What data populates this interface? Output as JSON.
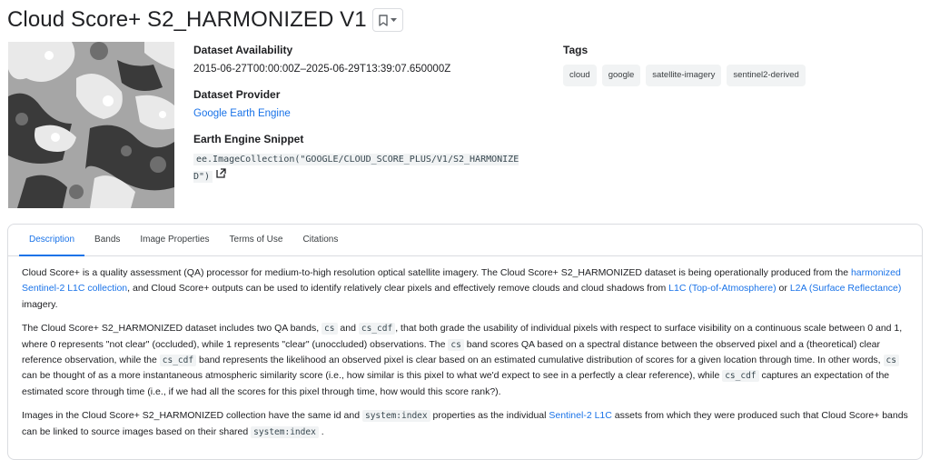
{
  "header": {
    "title": "Cloud Score+ S2_HARMONIZED V1"
  },
  "availability": {
    "label": "Dataset Availability",
    "value": "2015-06-27T00:00:00Z–2025-06-29T13:39:07.650000Z"
  },
  "provider": {
    "label": "Dataset Provider",
    "value": "Google Earth Engine"
  },
  "snippet": {
    "label": "Earth Engine Snippet",
    "value": "ee.ImageCollection(\"GOOGLE/CLOUD_SCORE_PLUS/V1/S2_HARMONIZED\")"
  },
  "tags": {
    "label": "Tags",
    "items": [
      "cloud",
      "google",
      "satellite-imagery",
      "sentinel2-derived"
    ]
  },
  "tabs": [
    "Description",
    "Bands",
    "Image Properties",
    "Terms of Use",
    "Citations"
  ],
  "description": {
    "p1": {
      "t1": "Cloud Score+ is a quality assessment (QA) processor for medium-to-high resolution optical satellite imagery. The Cloud Score+ S2_HARMONIZED dataset is being operationally produced from the ",
      "link1": "harmonized Sentinel-2 L1C collection",
      "t2": ", and Cloud Score+ outputs can be used to identify relatively clear pixels and effectively remove clouds and cloud shadows from ",
      "link2": "L1C (Top-of-Atmosphere)",
      "t3": " or ",
      "link3": "L2A (Surface Reflectance)",
      "t4": " imagery."
    },
    "p2": {
      "t1": "The Cloud Score+ S2_HARMONIZED dataset includes two QA bands, ",
      "c1": "cs",
      "t2": " and ",
      "c2": "cs_cdf",
      "t3": ", that both grade the usability of individual pixels with respect to surface visibility on a continuous scale between 0 and 1, where 0 represents \"not clear\" (occluded), while 1 represents \"clear\" (unoccluded) observations. The ",
      "c3": "cs",
      "t4": " band scores QA based on a spectral distance between the observed pixel and a (theoretical) clear reference observation, while the ",
      "c4": "cs_cdf",
      "t5": " band represents the likelihood an observed pixel is clear based on an estimated cumulative distribution of scores for a given location through time. In other words, ",
      "c5": "cs",
      "t6": " can be thought of as a more instantaneous atmospheric similarity score (i.e., how similar is this pixel to what we'd expect to see in a perfectly a clear reference), while ",
      "c6": "cs_cdf",
      "t7": " captures an expectation of the estimated score through time (i.e., if we had all the scores for this pixel through time, how would this score rank?)."
    },
    "p3": {
      "t1": "Images in the Cloud Score+ S2_HARMONIZED collection have the same id and ",
      "c1": "system:index",
      "t2": " properties as the individual ",
      "link1": "Sentinel-2 L1C",
      "t3": " assets from which they were produced such that Cloud Score+ bands can be linked to source images based on their shared ",
      "c2": "system:index",
      "t4": " ."
    }
  }
}
